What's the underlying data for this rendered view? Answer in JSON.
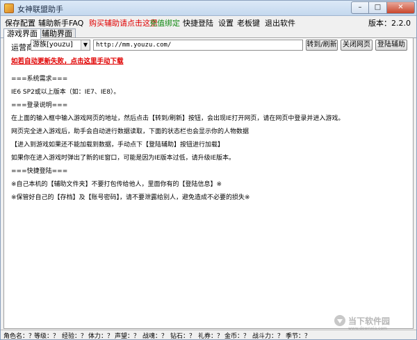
{
  "window": {
    "title": "女神联盟助手",
    "minimize": "–",
    "maximize": "□",
    "close": "✕"
  },
  "menu": {
    "items": [
      "保存配置",
      "辅助新手FAQ",
      "购买辅助请点击这里",
      "充值绑定",
      "快捷登陆",
      "设置",
      "老板键",
      "退出软件"
    ],
    "version": "版本：2.2.0"
  },
  "tabs": [
    "游戏界面",
    "辅助界面"
  ],
  "addr": {
    "label": "运营商",
    "operator": "游族[youzu]",
    "url": "http://mm.youzu.com/",
    "buttons": [
      "转到/刷新",
      "关闭网页",
      "登陆辅助"
    ]
  },
  "body": {
    "link": "如若自动更新失败，点击这里手动下载",
    "lines": [
      "===系统需求===",
      "IE6 SP2或以上版本（如：IE7、IE8）。",
      "===登录说明===",
      "在上面的输入框中输入游戏网页的地址，然后点击【转到/刷新】按钮，会出现IE打开网页，请在网页中登录并进入游戏。",
      "网页完全进入游戏后，助手会自动进行数据读取，下面的状态栏也会显示你的人物数据",
      "【进入到游戏如果还不能加载到数据，手动点下【登陆辅助】按钮进行加载】",
      "如果你在进入游戏时弹出了新的IE窗口，可能是因为IE版本过低，请升级IE版本。",
      "===快捷登陆===",
      "※自己本机的【辅助文件夹】不要打包传给他人，里面你有的【登陆信息】※",
      "※保管好自己的【存档】及【账号密码】，请不要泄露给别人，避免造成不必要的损失※"
    ]
  },
  "status": [
    "角色名：？",
    "等级：？",
    "经验：？",
    "体力：？",
    "声望：？",
    "战魂：？",
    "钻石：？",
    "礼券：？",
    "金币：？",
    "战斗力：？",
    "季节：？"
  ],
  "watermark": {
    "main": "当下软件园",
    "sub": "www.downxia.com"
  },
  "colors": {
    "link": "#e00000",
    "menu_buy": "#e00000",
    "menu_recharge": "#138a13"
  }
}
